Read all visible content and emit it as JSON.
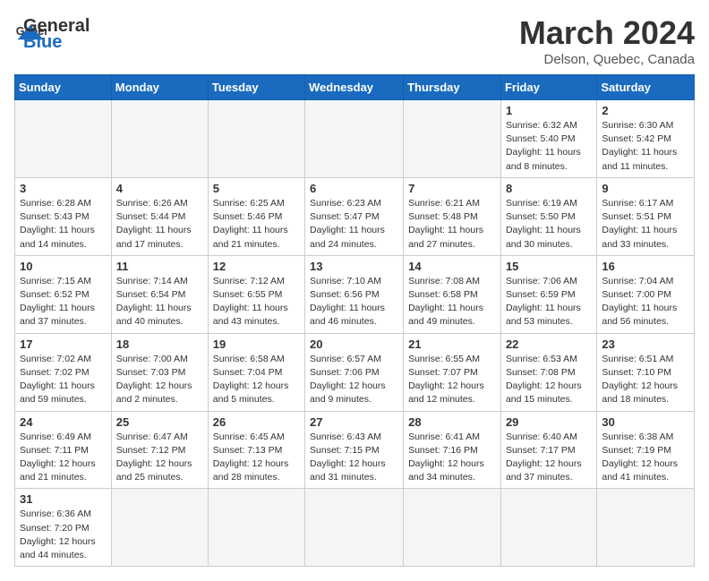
{
  "header": {
    "logo_general": "General",
    "logo_blue": "Blue",
    "month_title": "March 2024",
    "subtitle": "Delson, Quebec, Canada"
  },
  "days_of_week": [
    "Sunday",
    "Monday",
    "Tuesday",
    "Wednesday",
    "Thursday",
    "Friday",
    "Saturday"
  ],
  "weeks": [
    [
      {
        "day": "",
        "info": ""
      },
      {
        "day": "",
        "info": ""
      },
      {
        "day": "",
        "info": ""
      },
      {
        "day": "",
        "info": ""
      },
      {
        "day": "",
        "info": ""
      },
      {
        "day": "1",
        "info": "Sunrise: 6:32 AM\nSunset: 5:40 PM\nDaylight: 11 hours\nand 8 minutes."
      },
      {
        "day": "2",
        "info": "Sunrise: 6:30 AM\nSunset: 5:42 PM\nDaylight: 11 hours\nand 11 minutes."
      }
    ],
    [
      {
        "day": "3",
        "info": "Sunrise: 6:28 AM\nSunset: 5:43 PM\nDaylight: 11 hours\nand 14 minutes."
      },
      {
        "day": "4",
        "info": "Sunrise: 6:26 AM\nSunset: 5:44 PM\nDaylight: 11 hours\nand 17 minutes."
      },
      {
        "day": "5",
        "info": "Sunrise: 6:25 AM\nSunset: 5:46 PM\nDaylight: 11 hours\nand 21 minutes."
      },
      {
        "day": "6",
        "info": "Sunrise: 6:23 AM\nSunset: 5:47 PM\nDaylight: 11 hours\nand 24 minutes."
      },
      {
        "day": "7",
        "info": "Sunrise: 6:21 AM\nSunset: 5:48 PM\nDaylight: 11 hours\nand 27 minutes."
      },
      {
        "day": "8",
        "info": "Sunrise: 6:19 AM\nSunset: 5:50 PM\nDaylight: 11 hours\nand 30 minutes."
      },
      {
        "day": "9",
        "info": "Sunrise: 6:17 AM\nSunset: 5:51 PM\nDaylight: 11 hours\nand 33 minutes."
      }
    ],
    [
      {
        "day": "10",
        "info": "Sunrise: 7:15 AM\nSunset: 6:52 PM\nDaylight: 11 hours\nand 37 minutes."
      },
      {
        "day": "11",
        "info": "Sunrise: 7:14 AM\nSunset: 6:54 PM\nDaylight: 11 hours\nand 40 minutes."
      },
      {
        "day": "12",
        "info": "Sunrise: 7:12 AM\nSunset: 6:55 PM\nDaylight: 11 hours\nand 43 minutes."
      },
      {
        "day": "13",
        "info": "Sunrise: 7:10 AM\nSunset: 6:56 PM\nDaylight: 11 hours\nand 46 minutes."
      },
      {
        "day": "14",
        "info": "Sunrise: 7:08 AM\nSunset: 6:58 PM\nDaylight: 11 hours\nand 49 minutes."
      },
      {
        "day": "15",
        "info": "Sunrise: 7:06 AM\nSunset: 6:59 PM\nDaylight: 11 hours\nand 53 minutes."
      },
      {
        "day": "16",
        "info": "Sunrise: 7:04 AM\nSunset: 7:00 PM\nDaylight: 11 hours\nand 56 minutes."
      }
    ],
    [
      {
        "day": "17",
        "info": "Sunrise: 7:02 AM\nSunset: 7:02 PM\nDaylight: 11 hours\nand 59 minutes."
      },
      {
        "day": "18",
        "info": "Sunrise: 7:00 AM\nSunset: 7:03 PM\nDaylight: 12 hours\nand 2 minutes."
      },
      {
        "day": "19",
        "info": "Sunrise: 6:58 AM\nSunset: 7:04 PM\nDaylight: 12 hours\nand 5 minutes."
      },
      {
        "day": "20",
        "info": "Sunrise: 6:57 AM\nSunset: 7:06 PM\nDaylight: 12 hours\nand 9 minutes."
      },
      {
        "day": "21",
        "info": "Sunrise: 6:55 AM\nSunset: 7:07 PM\nDaylight: 12 hours\nand 12 minutes."
      },
      {
        "day": "22",
        "info": "Sunrise: 6:53 AM\nSunset: 7:08 PM\nDaylight: 12 hours\nand 15 minutes."
      },
      {
        "day": "23",
        "info": "Sunrise: 6:51 AM\nSunset: 7:10 PM\nDaylight: 12 hours\nand 18 minutes."
      }
    ],
    [
      {
        "day": "24",
        "info": "Sunrise: 6:49 AM\nSunset: 7:11 PM\nDaylight: 12 hours\nand 21 minutes."
      },
      {
        "day": "25",
        "info": "Sunrise: 6:47 AM\nSunset: 7:12 PM\nDaylight: 12 hours\nand 25 minutes."
      },
      {
        "day": "26",
        "info": "Sunrise: 6:45 AM\nSunset: 7:13 PM\nDaylight: 12 hours\nand 28 minutes."
      },
      {
        "day": "27",
        "info": "Sunrise: 6:43 AM\nSunset: 7:15 PM\nDaylight: 12 hours\nand 31 minutes."
      },
      {
        "day": "28",
        "info": "Sunrise: 6:41 AM\nSunset: 7:16 PM\nDaylight: 12 hours\nand 34 minutes."
      },
      {
        "day": "29",
        "info": "Sunrise: 6:40 AM\nSunset: 7:17 PM\nDaylight: 12 hours\nand 37 minutes."
      },
      {
        "day": "30",
        "info": "Sunrise: 6:38 AM\nSunset: 7:19 PM\nDaylight: 12 hours\nand 41 minutes."
      }
    ],
    [
      {
        "day": "31",
        "info": "Sunrise: 6:36 AM\nSunset: 7:20 PM\nDaylight: 12 hours\nand 44 minutes."
      },
      {
        "day": "",
        "info": ""
      },
      {
        "day": "",
        "info": ""
      },
      {
        "day": "",
        "info": ""
      },
      {
        "day": "",
        "info": ""
      },
      {
        "day": "",
        "info": ""
      },
      {
        "day": "",
        "info": ""
      }
    ]
  ]
}
